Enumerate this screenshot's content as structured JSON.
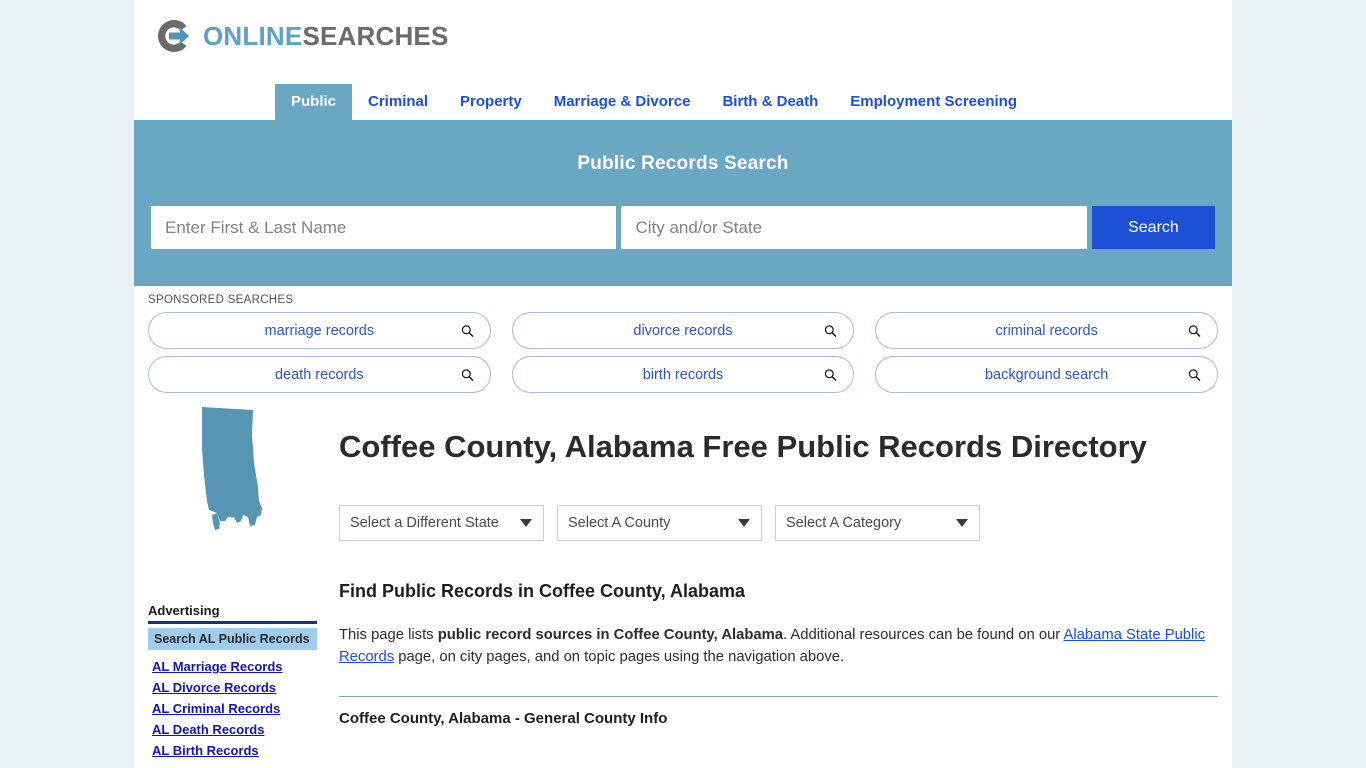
{
  "brand": {
    "logo_icon": "circular-arrow-logo-icon",
    "name_part1": "ONLINE",
    "name_part2": "SEARCHES",
    "teal": "#6aa7c2",
    "gray": "#6b6b6b",
    "link_blue": "#1a4fd8"
  },
  "nav": {
    "items": [
      {
        "label": "Public",
        "active": true
      },
      {
        "label": "Criminal",
        "active": false
      },
      {
        "label": "Property",
        "active": false
      },
      {
        "label": "Marriage & Divorce",
        "active": false
      },
      {
        "label": "Birth & Death",
        "active": false
      },
      {
        "label": "Employment Screening",
        "active": false
      }
    ]
  },
  "search": {
    "title": "Public Records Search",
    "name_placeholder": "Enter First & Last Name",
    "name_value": "",
    "city_placeholder": "City and/or State",
    "city_value": "",
    "button_label": "Search",
    "button_color": "#1e50d5"
  },
  "sponsored": {
    "label": "SPONSORED SEARCHES",
    "icon": "magnifier-icon",
    "items": [
      {
        "label": "marriage records"
      },
      {
        "label": "divorce records"
      },
      {
        "label": "criminal records"
      },
      {
        "label": "death records"
      },
      {
        "label": "birth records"
      },
      {
        "label": "background search"
      }
    ]
  },
  "sidebar": {
    "map_icon": "alabama-state-map-icon",
    "map_color": "#5795b4",
    "advertising_label": "Advertising",
    "ad_box_label": "Search AL Public Records",
    "ad_box_color": "#9fcdef",
    "links": [
      {
        "label": "AL Marriage Records"
      },
      {
        "label": "AL Divorce Records"
      },
      {
        "label": "AL Criminal Records"
      },
      {
        "label": "AL Death Records"
      },
      {
        "label": "AL Birth Records"
      }
    ]
  },
  "main": {
    "page_title": "Coffee County, Alabama Free Public Records Directory",
    "selects": [
      {
        "label": "Select a Different State",
        "caret": "chevron-down-icon"
      },
      {
        "label": "Select A County",
        "caret": "chevron-down-icon"
      },
      {
        "label": "Select A Category",
        "caret": "chevron-down-icon"
      }
    ],
    "section_heading": "Find Public Records in Coffee County, Alabama",
    "paragraph": {
      "text_1": "This page lists ",
      "bold_1": "public record sources in Coffee County, Alabama",
      "text_2": ". Additional resources can be found on our ",
      "link_1": "Alabama State Public Records",
      "text_3": " page, on city pages, and on topic pages using the navigation above."
    },
    "sub_heading": "Coffee County, Alabama - General County Info"
  }
}
